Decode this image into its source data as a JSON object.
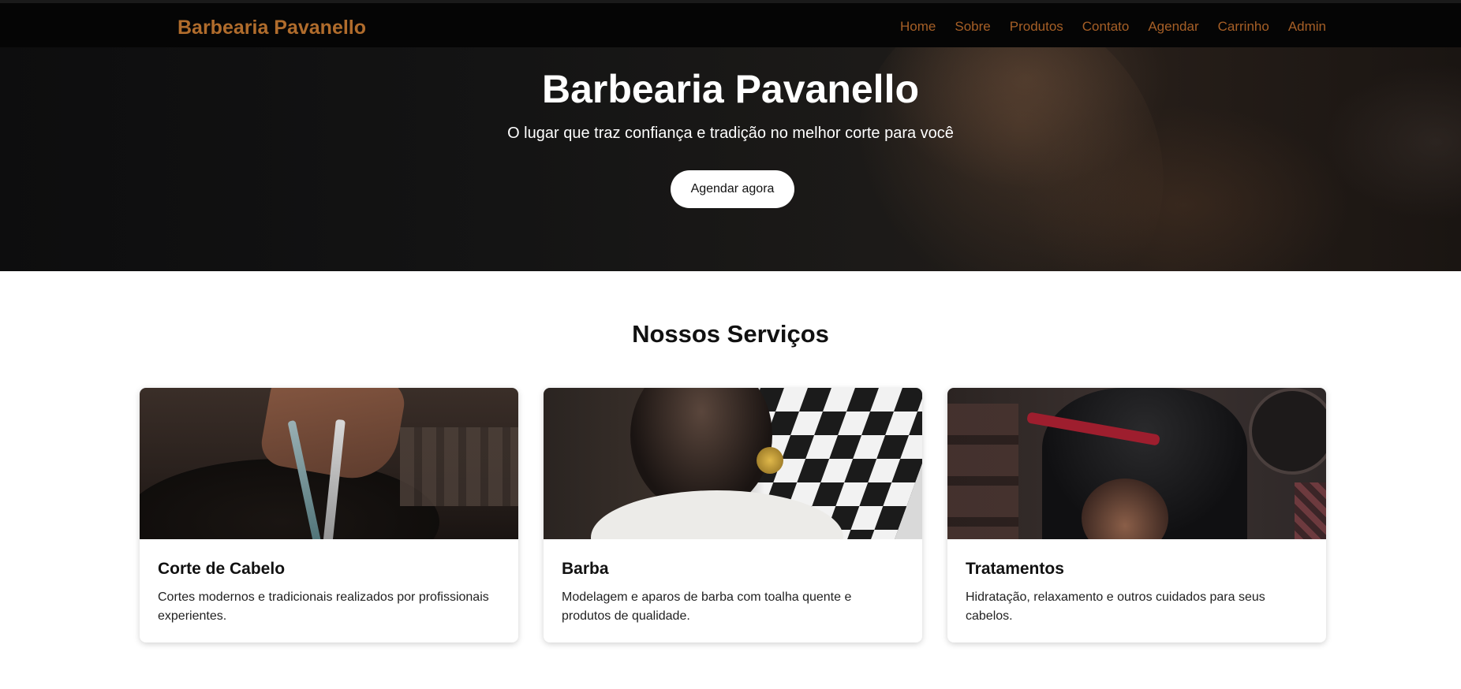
{
  "nav": {
    "brand": "Barbearia Pavanello",
    "links": [
      "Home",
      "Sobre",
      "Produtos",
      "Contato",
      "Agendar",
      "Carrinho",
      "Admin"
    ]
  },
  "hero": {
    "title": "Barbearia Pavanello",
    "subtitle": "O lugar que traz confiança e tradição no melhor corte para você",
    "cta": "Agendar agora"
  },
  "services": {
    "title": "Nossos Serviços",
    "cards": [
      {
        "title": "Corte de Cabelo",
        "text": "Cortes modernos e tradicionais realizados por profissionais experientes."
      },
      {
        "title": "Barba",
        "text": "Modelagem e aparos de barba com toalha quente e produtos de qualidade."
      },
      {
        "title": "Tratamentos",
        "text": "Hidratação, relaxamento e outros cuidados para seus cabelos."
      }
    ]
  },
  "colors": {
    "nav_background": "#050505",
    "brand": "#b06c2c",
    "nav_link": "#a65f26",
    "button_background": "#ffffff"
  }
}
